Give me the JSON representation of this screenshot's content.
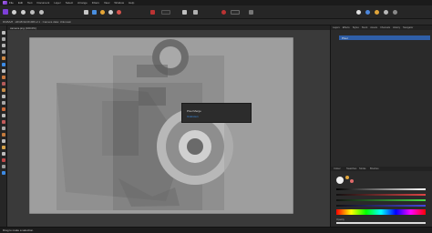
{
  "menubar": {
    "items": [
      "File",
      "Edit",
      "Text",
      "Document",
      "Layer",
      "Select",
      "Arrange",
      "Filters",
      "View",
      "Window",
      "Help"
    ]
  },
  "context_bar": {
    "text": "RGBA/8 · sRGB IEC61966-2.1 · Camera data: Unknown"
  },
  "document_tab": {
    "title": "camera.png (100.0%)"
  },
  "popup": {
    "title": "Pixel Merge",
    "subtitle": "Unknown"
  },
  "right_panel": {
    "top_tabs": [
      "Layers",
      "Effects",
      "Styles",
      "Stock",
      "Assets",
      "Channels",
      "History",
      "Navigator"
    ],
    "layer_name": "Pixel",
    "bottom_tabs": [
      "Colour",
      "Swatches",
      "Stroke",
      "Brushes"
    ],
    "opacity_label": "Opacity"
  },
  "statusbar": {
    "text": "Drag to make a selection."
  },
  "colors": {
    "accent": "#3b8ee8",
    "layer_highlight": "#2f5fa8",
    "background": "#1e1e1e",
    "canvas": "#9e9e9e"
  }
}
